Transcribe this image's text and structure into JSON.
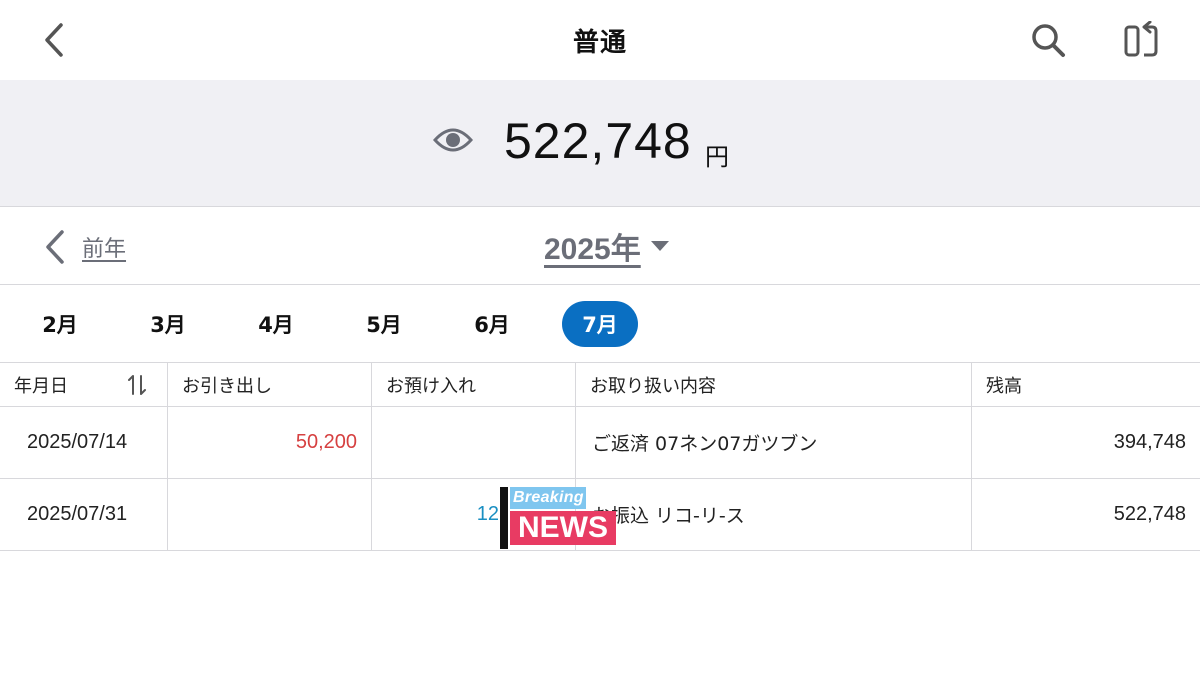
{
  "header": {
    "title": "普通",
    "back_icon": "chevron-left-icon",
    "search_icon": "search-icon",
    "switch_icon": "switch-account-icon"
  },
  "balance": {
    "amount": "522,748",
    "unit": "円",
    "eye_icon": "eye-icon"
  },
  "year_nav": {
    "prev_label": "前年",
    "year_label": "2025年"
  },
  "months": {
    "tabs": [
      {
        "label": "2月",
        "active": false
      },
      {
        "label": "3月",
        "active": false
      },
      {
        "label": "4月",
        "active": false
      },
      {
        "label": "5月",
        "active": false
      },
      {
        "label": "6月",
        "active": false
      },
      {
        "label": "7月",
        "active": true
      }
    ]
  },
  "table": {
    "headers": [
      "年月日",
      "お引き出し",
      "お預け入れ",
      "お取り扱い内容",
      "残高"
    ],
    "rows": [
      {
        "date": "2025/07/14",
        "withdrawal": "50,200",
        "deposit": "",
        "description": "ご返済 07ネン07ガツブン",
        "balance": "394,748"
      },
      {
        "date": "2025/07/31",
        "withdrawal": "",
        "deposit": "12",
        "description": "お振込 リコ-リ-ス",
        "balance": "522,748"
      }
    ]
  },
  "sticker": {
    "top_text": "Breaking",
    "bottom_text": "NEWS"
  },
  "colors": {
    "accent": "#0a6fc2",
    "withdrawal": "#d64040",
    "deposit": "#1a8fc2",
    "band": "#f0f0f4"
  }
}
